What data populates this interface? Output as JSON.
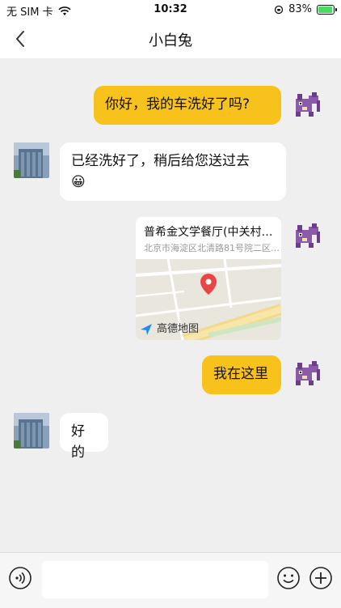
{
  "status_bar": {
    "carrier": "无 SIM 卡",
    "time": "10:32",
    "battery": "83%",
    "battery_level": 0.83
  },
  "nav": {
    "title": "小白兔"
  },
  "messages": [
    {
      "side": "out",
      "type": "text",
      "text": "你好，我的车洗好了吗?"
    },
    {
      "side": "in",
      "type": "text",
      "text": "已经洗好了，稍后给您送过去",
      "emoji": "😀"
    },
    {
      "side": "out",
      "type": "location",
      "title": "普希金文学餐厅(中关村…",
      "address": "北京市海淀区北清路81号院二区…",
      "map_brand": "高德地图"
    },
    {
      "side": "out",
      "type": "text",
      "text": "我在这里"
    },
    {
      "side": "in",
      "type": "text",
      "text": "好的"
    }
  ],
  "input_bar": {
    "placeholder": ""
  },
  "icons": {
    "back": "chevron-left-icon",
    "voice": "voice-icon",
    "emoji": "emoji-icon",
    "plus": "plus-icon",
    "wifi": "wifi-icon",
    "battery": "battery-icon"
  }
}
